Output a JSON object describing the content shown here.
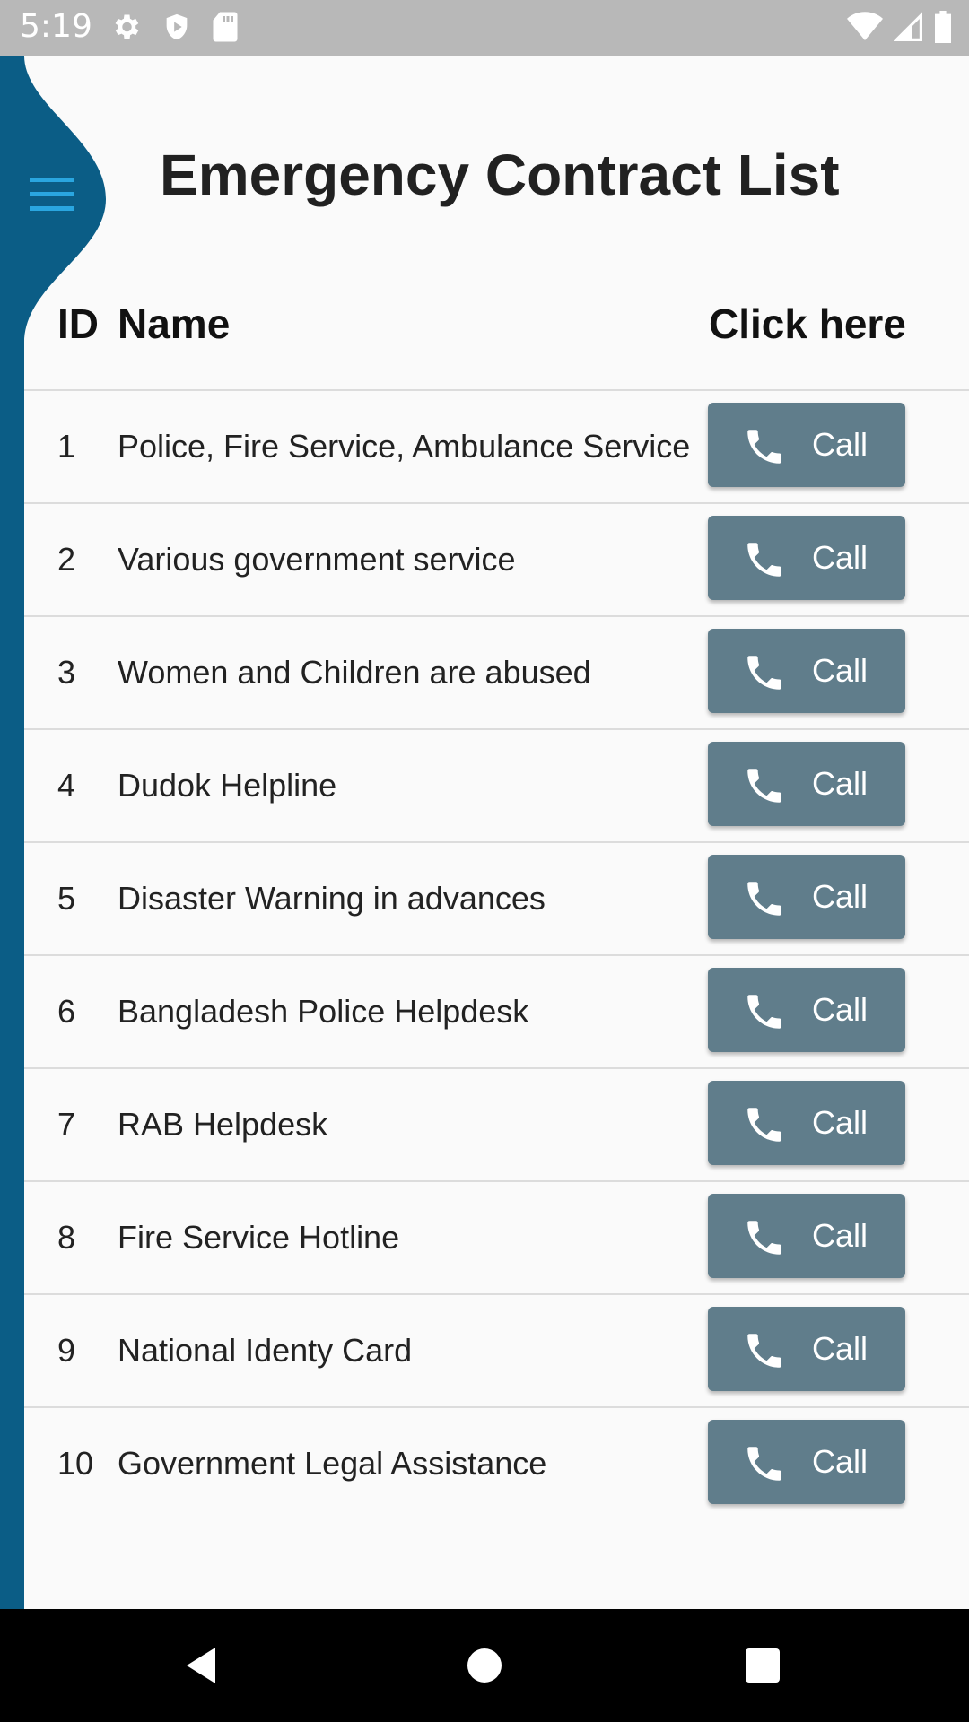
{
  "status_bar": {
    "time": "5:19",
    "left_icons": [
      "settings-icon",
      "shield-icon",
      "sd-card-icon"
    ],
    "right_icons": [
      "wifi-icon",
      "cell-signal-icon",
      "battery-icon"
    ]
  },
  "app": {
    "title": "Emergency Contract List",
    "menu_icon": "menu-icon",
    "accent_color": "#0b5d86",
    "button_color": "#607d8b"
  },
  "table": {
    "headers": {
      "id": "ID",
      "name": "Name",
      "action": "Click here"
    },
    "call_label": "Call",
    "rows": [
      {
        "id": "1",
        "name": "Police, Fire Service, Ambulance Service"
      },
      {
        "id": "2",
        "name": "Various government service"
      },
      {
        "id": "3",
        "name": "Women and Children are abused"
      },
      {
        "id": "4",
        "name": "Dudok Helpline"
      },
      {
        "id": "5",
        "name": "Disaster Warning in advances"
      },
      {
        "id": "6",
        "name": "Bangladesh Police Helpdesk"
      },
      {
        "id": "7",
        "name": "RAB Helpdesk"
      },
      {
        "id": "8",
        "name": "Fire Service Hotline"
      },
      {
        "id": "9",
        "name": "National Identy Card"
      },
      {
        "id": "10",
        "name": "Government Legal Assistance"
      }
    ]
  },
  "nav_bar": {
    "icons": [
      "back-icon",
      "home-icon",
      "recents-icon"
    ]
  }
}
